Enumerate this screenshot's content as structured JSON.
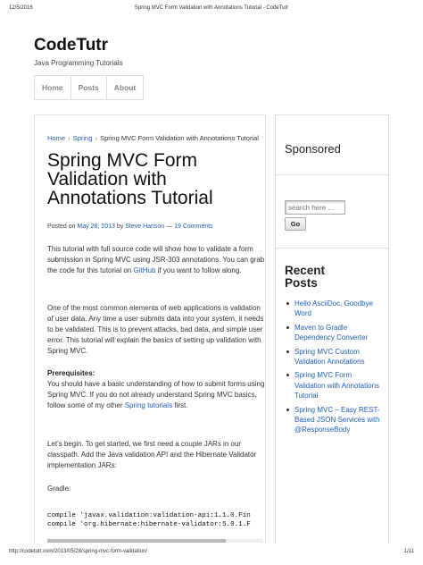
{
  "print_header": {
    "date": "12/5/2016",
    "title": "Spring MVC Form Validation with Annotations Tutorial - CodeTutr"
  },
  "site": {
    "title": "CodeTutr",
    "description": "Java Programming Tutorials"
  },
  "nav": {
    "items": [
      "Home",
      "Posts",
      "About"
    ]
  },
  "breadcrumb": {
    "home": "Home",
    "separator": "›",
    "category": "Spring",
    "current": "Spring MVC Form Validation with Annotations Tutorial"
  },
  "post": {
    "title": "Spring MVC Form Validation with Annotations Tutorial",
    "byline": {
      "posted_on": "Posted on",
      "date": "May 28, 2013",
      "by": "by",
      "author": "Steve Hanson",
      "dash": "—",
      "comments": "19 Comments"
    },
    "intro": {
      "text": "This tutorial with full source code will show how to validate a form submission in Spring MVC using JSR-303 annotations. You can grab the code for this tutorial on",
      "link": "GitHub",
      "after": "if you want to follow along."
    },
    "para2": "One of the most common elements of web applications is validation of user data. Any time a user submits data into your system, it needs to be validated. This is to prevent attacks, bad data, and simple user error. This tutorial will explain the basics of setting up validation with Spring MVC.",
    "prereq": {
      "heading": "Prerequisites:",
      "text": "You should have a basic understanding of how to submit forms using Spring MVC. If you do not already understand Spring MVC basics, follow some of my other",
      "link": "Spring tutorials",
      "after": "first."
    },
    "para4": "Let's begin. To get started, we first need a couple JARs in our classpath. Add the Java validation API and the Hibernate Validator implementation JARs:",
    "gradle_label": "Gradle:",
    "code_lines": [
      "compile 'javax.validation:validation-api:1.1.0.Fin",
      "compile 'org.hibernate:hibernate-validator:5.0.1.F"
    ]
  },
  "sidebar": {
    "sponsored_title": "Sponsored",
    "search_placeholder": "search here ...",
    "go_label": "Go",
    "recent_title": "Recent Posts",
    "recent_posts": [
      "Hello AsciiDoc, Goodbye Word",
      "Maven to Gradle Dependency Converter",
      "Spring MVC Custom Validation Annotations",
      "Spring MVC Form Validation with Annotations Tutorial",
      "Spring MVC – Easy REST-Based JSON Services with @ResponseBody"
    ]
  },
  "print_footer": {
    "url": "http://codetutr.com/2013/05/28/spring-mvc-form-validation/",
    "page": "1/11"
  },
  "colors": {
    "link": "#1e5fb8",
    "text": "#333333",
    "border": "#e2e2e2"
  }
}
